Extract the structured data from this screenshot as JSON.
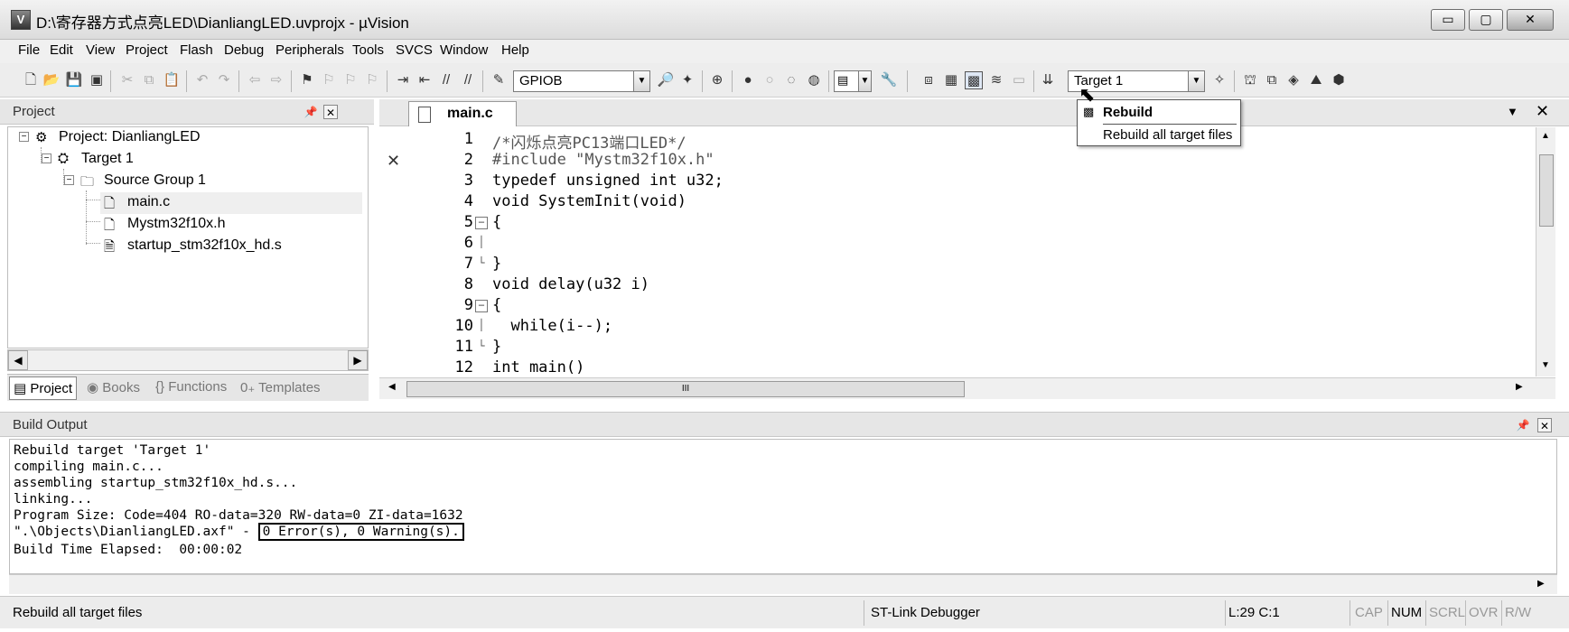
{
  "window": {
    "title": "D:\\寄存器方式点亮LED\\DianliangLED.uvprojx - µVision",
    "min_glyph": "▭",
    "max_glyph": "▢",
    "close_glyph": "✕"
  },
  "menu": [
    "File",
    "Edit",
    "View",
    "Project",
    "Flash",
    "Debug",
    "Peripherals",
    "Tools",
    "SVCS",
    "Window",
    "Help"
  ],
  "toolbar": {
    "find_combo_value": "GPIOB",
    "target_combo_value": "Target 1"
  },
  "project_panel": {
    "title": "Project",
    "tree": {
      "project_label": "Project: DianliangLED",
      "target_label": "Target 1",
      "group_label": "Source Group 1",
      "files": [
        "main.c",
        "Mystm32f10x.h",
        "startup_stm32f10x_hd.s"
      ]
    },
    "tabs": [
      "Project",
      "Books",
      "Functions",
      "Templates"
    ],
    "tab_icons": [
      "▤",
      "◉",
      "{}",
      "0₊"
    ]
  },
  "editor": {
    "active_tab": "main.c",
    "lines": [
      {
        "num": "1",
        "fold": "",
        "text": "/*闪烁点亮PC13端口LED*/",
        "style": "gray"
      },
      {
        "num": "2",
        "fold": "",
        "text": "#include \"Mystm32f10x.h\"",
        "style": "gray"
      },
      {
        "num": "3",
        "fold": "",
        "text": "typedef unsigned int u32;",
        "style": ""
      },
      {
        "num": "4",
        "fold": "",
        "text": "void SystemInit(void)",
        "style": ""
      },
      {
        "num": "5",
        "fold": "⊟",
        "text": "{",
        "style": ""
      },
      {
        "num": "6",
        "fold": "│",
        "text": "",
        "style": ""
      },
      {
        "num": "7",
        "fold": "└",
        "text": "}",
        "style": ""
      },
      {
        "num": "8",
        "fold": "",
        "text": "void delay(u32 i)",
        "style": ""
      },
      {
        "num": "9",
        "fold": "⊟",
        "text": "{",
        "style": ""
      },
      {
        "num": "10",
        "fold": "│",
        "text": "  while(i--);",
        "style": ""
      },
      {
        "num": "11",
        "fold": "└",
        "text": "}",
        "style": ""
      },
      {
        "num": "12",
        "fold": "",
        "text": "int main()",
        "style": ""
      }
    ],
    "gutter_mark": "✕",
    "hscroll_glyph": "III"
  },
  "tooltip": {
    "title": "Rebuild",
    "description": "Rebuild all target files"
  },
  "build_output": {
    "title": "Build Output",
    "lines": [
      "Rebuild target 'Target 1'",
      "compiling main.c...",
      "assembling startup_stm32f10x_hd.s...",
      "linking...",
      "Program Size: Code=404 RO-data=320 RW-data=0 ZI-data=1632"
    ],
    "axf_prefix": "\".\\Objects\\DianliangLED.axf\" - ",
    "result": "0 Error(s), 0 Warning(s).",
    "elapsed": "Build Time Elapsed:  00:00:02"
  },
  "statusbar": {
    "message": "Rebuild all target files",
    "debugger": "ST-Link Debugger",
    "position": "L:29 C:1",
    "indicators": [
      {
        "label": "CAP",
        "active": false
      },
      {
        "label": "NUM",
        "active": true
      },
      {
        "label": "SCRL",
        "active": false
      },
      {
        "label": "OVR",
        "active": false
      },
      {
        "label": "R/W",
        "active": false
      }
    ]
  }
}
